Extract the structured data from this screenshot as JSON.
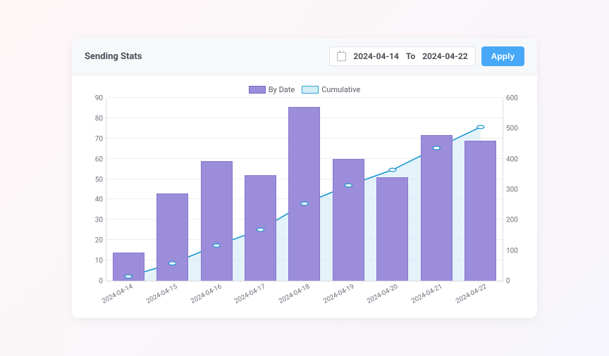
{
  "header": {
    "title": "Sending Stats",
    "date_from": "2024-04-14",
    "to_label": "To",
    "date_to": "2024-04-22",
    "apply_label": "Apply"
  },
  "legend": {
    "by_date": "By Date",
    "cumulative": "Cumulative"
  },
  "chart_data": {
    "type": "bar",
    "categories": [
      "2024-04-14",
      "2024-04-15",
      "2024-04-16",
      "2024-04-17",
      "2024-04-18",
      "2024-04-19",
      "2024-04-20",
      "2024-04-21",
      "2024-04-22"
    ],
    "series": [
      {
        "name": "By Date",
        "kind": "bar",
        "axis": "left",
        "values": [
          14,
          43,
          59,
          52,
          86,
          60,
          51,
          72,
          69
        ]
      },
      {
        "name": "Cumulative",
        "kind": "line-area",
        "axis": "right",
        "values": [
          14,
          57,
          116,
          168,
          254,
          314,
          365,
          437,
          506
        ]
      }
    ],
    "y_left": {
      "min": 0,
      "max": 90,
      "step": 10,
      "ticks": [
        0,
        10,
        20,
        30,
        40,
        50,
        60,
        70,
        80,
        90
      ]
    },
    "y_right": {
      "min": 0,
      "max": 600,
      "step": 100,
      "ticks": [
        0,
        100,
        200,
        300,
        400,
        500,
        600
      ]
    },
    "colors": {
      "bar": "#9b8dd9",
      "bar_border": "#8876cf",
      "line": "#1996d1",
      "area": "#d5edf7"
    }
  }
}
